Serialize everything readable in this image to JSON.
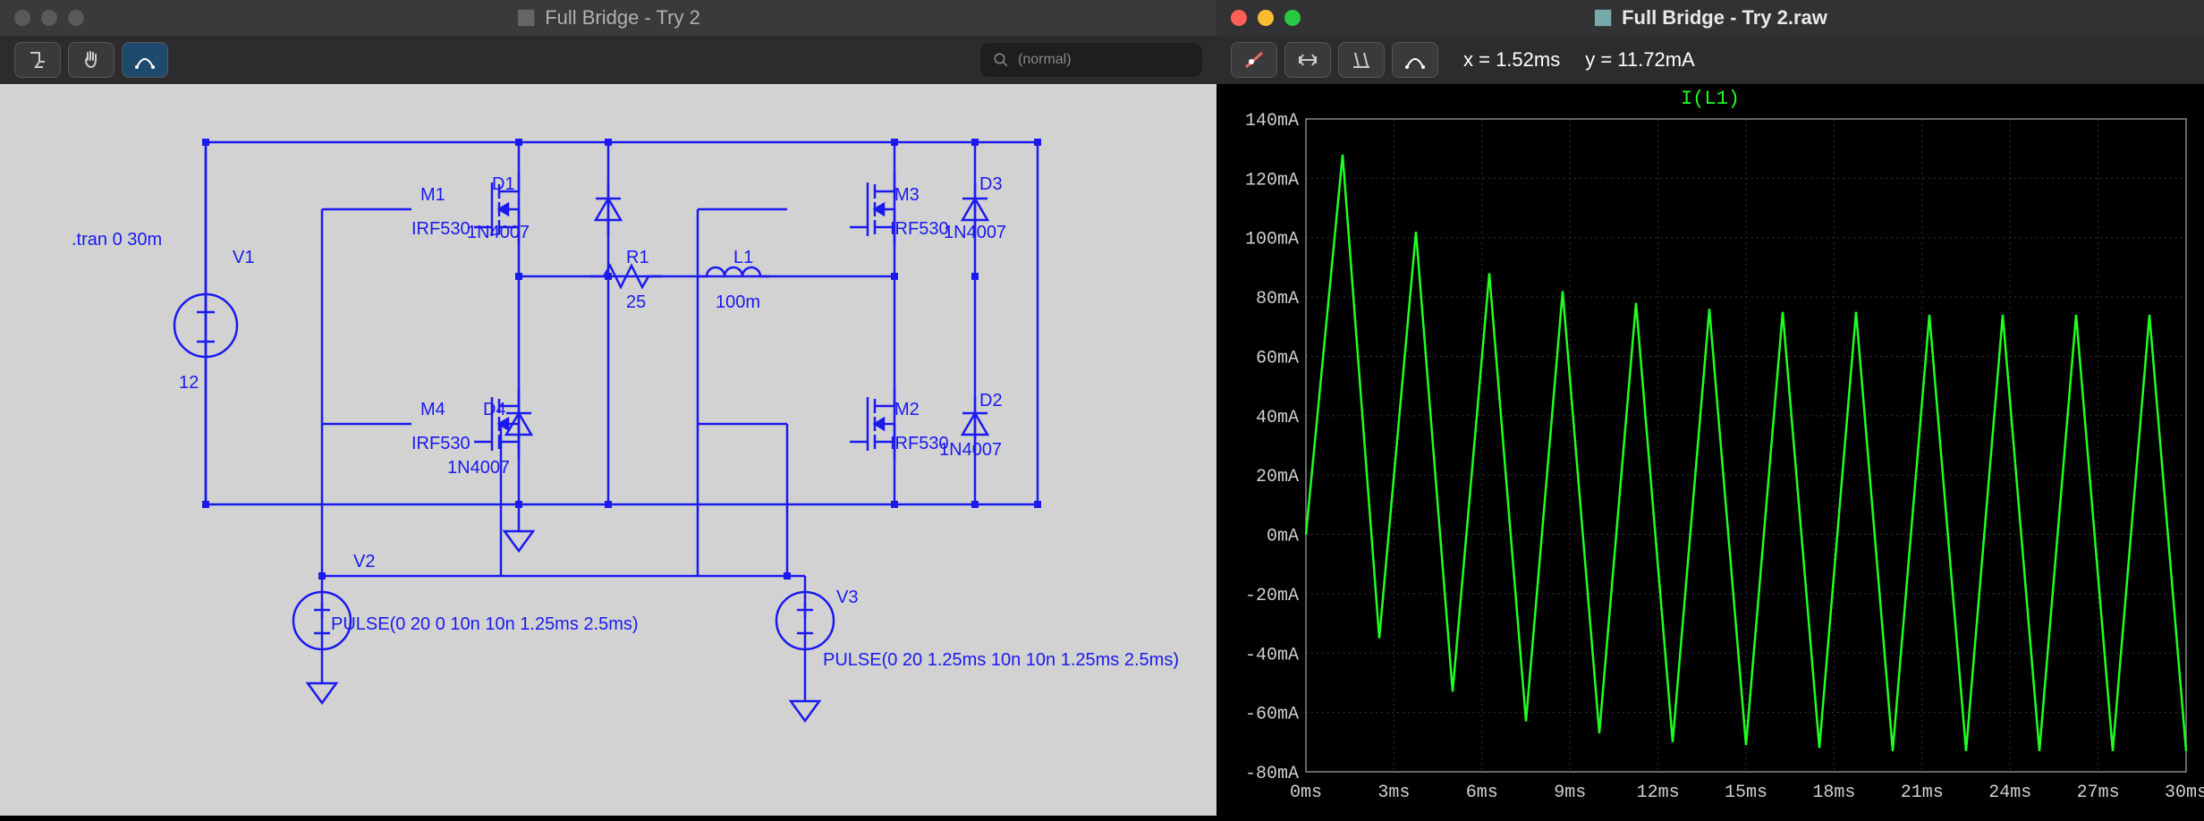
{
  "left_window": {
    "title": "Full Bridge - Try 2",
    "search_placeholder": "(normal)",
    "directive": ".tran 0 30m",
    "components": {
      "V1": {
        "name": "V1",
        "value": "12"
      },
      "V2": {
        "name": "V2",
        "value": "PULSE(0 20 0 10n 10n 1.25ms 2.5ms)"
      },
      "V3": {
        "name": "V3",
        "value": "PULSE(0 20 1.25ms 10n 10n 1.25ms 2.5ms)"
      },
      "M1": {
        "name": "M1",
        "model": "IRF530"
      },
      "M2": {
        "name": "M2",
        "model": "IRF530"
      },
      "M3": {
        "name": "M3",
        "model": "IRF530"
      },
      "M4": {
        "name": "M4",
        "model": "IRF530"
      },
      "D1": {
        "name": "D1",
        "model": "1N4007"
      },
      "D2": {
        "name": "D2",
        "model": "1N4007"
      },
      "D3": {
        "name": "D3",
        "model": "1N4007"
      },
      "D4": {
        "name": "D4",
        "model": "1N4007"
      },
      "R1": {
        "name": "R1",
        "value": "25"
      },
      "L1": {
        "name": "L1",
        "value": "100m"
      }
    }
  },
  "right_window": {
    "title": "Full Bridge - Try 2.raw",
    "cursor_x": "x = 1.52ms",
    "cursor_y": "y = 11.72mA",
    "trace_label": "I(L1)"
  },
  "chart_data": {
    "type": "line",
    "title": "I(L1)",
    "xlabel": "",
    "ylabel": "",
    "xlim": [
      0,
      30
    ],
    "ylim": [
      -80,
      140
    ],
    "x_ticks": [
      "0ms",
      "3ms",
      "6ms",
      "9ms",
      "12ms",
      "15ms",
      "18ms",
      "21ms",
      "24ms",
      "27ms",
      "30ms"
    ],
    "y_ticks": [
      "-80mA",
      "-60mA",
      "-40mA",
      "-20mA",
      "0mA",
      "20mA",
      "40mA",
      "60mA",
      "80mA",
      "100mA",
      "120mA",
      "140mA"
    ],
    "series": [
      {
        "name": "I(L1)",
        "color": "#20ff20",
        "x": [
          0,
          1.25,
          2.5,
          3.75,
          5.0,
          6.25,
          7.5,
          8.75,
          10.0,
          11.25,
          12.5,
          13.75,
          15.0,
          16.25,
          17.5,
          18.75,
          20.0,
          21.25,
          22.5,
          23.75,
          25.0,
          26.25,
          27.5,
          28.75,
          30.0
        ],
        "y": [
          0,
          128,
          -35,
          102,
          -53,
          88,
          -63,
          82,
          -67,
          78,
          -70,
          76,
          -71,
          75,
          -72,
          75,
          -73,
          74,
          -73,
          74,
          -73,
          74,
          -73,
          74,
          -73
        ]
      }
    ]
  }
}
